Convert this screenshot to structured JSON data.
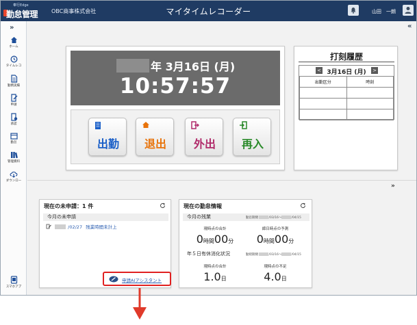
{
  "header": {
    "brand_sub": "奉行Edge",
    "brand_main": "勤怠管理",
    "company": "OBC商事株式会社",
    "title": "マイタイムレコーダー",
    "user_name": "山田　一朗"
  },
  "sidebar": {
    "toggle": "»",
    "items": [
      {
        "label": "ホーム",
        "icon": "home-icon"
      },
      {
        "label": "タイムレコ",
        "icon": "clock-icon"
      },
      {
        "label": "勤務実績",
        "icon": "document-icon"
      },
      {
        "label": "申請",
        "icon": "apply-icon"
      },
      {
        "label": "承認",
        "icon": "approve-icon"
      },
      {
        "label": "勤怠",
        "icon": "calendar-icon"
      },
      {
        "label": "管理資料",
        "icon": "books-icon"
      },
      {
        "label": "ダウンロー",
        "icon": "cloud-download-icon"
      }
    ],
    "bottom_item": {
      "label": "スマホアプ",
      "icon": "smartphone-icon"
    }
  },
  "clock": {
    "date": "年 3月16日 (月)",
    "time": "10:57:57"
  },
  "punch_buttons": [
    {
      "label": "出勤",
      "color": "#1a5fc8",
      "icon": "building-icon"
    },
    {
      "label": "退出",
      "color": "#e8730a",
      "icon": "home-icon"
    },
    {
      "label": "外出",
      "color": "#b02a6a",
      "icon": "exit-door-icon"
    },
    {
      "label": "再入",
      "color": "#2a8a2a",
      "icon": "enter-door-icon"
    }
  ],
  "history": {
    "title": "打刻履歴",
    "date": "3月16日 (月)",
    "prev": "<",
    "next": ">",
    "columns": [
      "出勤区分",
      "時刻"
    ],
    "rows": [
      [
        "",
        ""
      ],
      [
        "",
        ""
      ],
      [
        "",
        ""
      ]
    ]
  },
  "lower_toggle": "»",
  "pending": {
    "title": "現在の未申請：1 件",
    "subhead": "今月の未申請",
    "item_date": "/02/27",
    "item_text": "残業時間未計上",
    "ai_link": "申請AIアシスタント"
  },
  "attendance": {
    "title": "現在の勤怠情報",
    "overtime_head": "今月の残業",
    "overtime_period_label": "勤怠期間",
    "overtime_period_start": "/03/16～",
    "overtime_period_end": "/04/15",
    "current_total_label": "現時点の合計",
    "current_total": {
      "hours": "0",
      "h_unit": "時間",
      "minutes": "00",
      "m_unit": "分"
    },
    "forecast_label": "締日時点の予測",
    "forecast": {
      "hours": "0",
      "h_unit": "時間",
      "minutes": "00",
      "m_unit": "分"
    },
    "leave_head": "年５日有休消化状況",
    "leave_period_label": "勤続期間",
    "leave_period_start": "/03/16～",
    "leave_period_end": "/04/15",
    "leave_total_label": "現時点の合計",
    "leave_total": {
      "value": "1.0",
      "unit": "日"
    },
    "leave_short_label": "現時点の不足",
    "leave_short": {
      "value": "4.0",
      "unit": "日"
    }
  }
}
